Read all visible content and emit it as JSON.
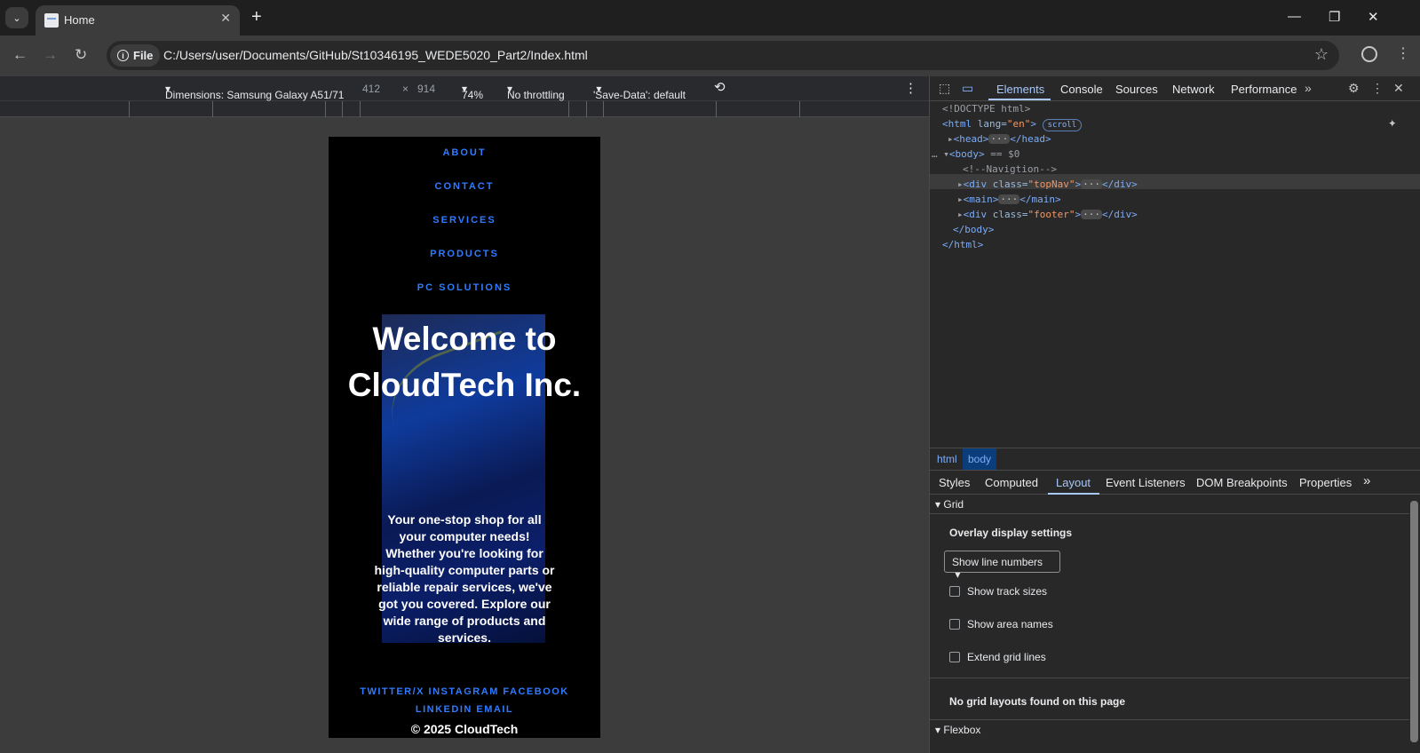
{
  "browser": {
    "tab_title": "Home",
    "url_scheme": "File",
    "url": "C:/Users/user/Documents/GitHub/St10346195_WEDE5020_Part2/Index.html"
  },
  "device_toolbar": {
    "dimensions_label": "Dimensions: Samsung Galaxy A51/71",
    "width": "412",
    "times": "×",
    "height": "914",
    "zoom": "74%",
    "throttling": "No throttling",
    "save_data": "'Save-Data': default"
  },
  "page": {
    "nav": [
      "ABOUT",
      "CONTACT",
      "SERVICES",
      "PRODUCTS",
      "PC SOLUTIONS"
    ],
    "hero_title": "Welcome to CloudTech Inc.",
    "hero_text": "Your one-stop shop for all your computer needs! Whether you're looking for high-quality computer parts or reliable repair services, we've got you covered. Explore our wide range of products and services.",
    "social_row1": "TWITTER/X  INSTAGRAM  FACEBOOK",
    "social_row2": "LINKEDIN  EMAIL",
    "copyright": "© 2025 CloudTech",
    "accent_color": "#2f7bff"
  },
  "devtools": {
    "tabs": [
      "Elements",
      "Console",
      "Sources",
      "Network",
      "Performance"
    ],
    "active_tab": "Elements",
    "dom": {
      "doctype": "<!DOCTYPE html>",
      "html_open": "<html",
      "html_attr": " lang=",
      "html_val": "\"en\"",
      "html_close": ">",
      "scroll_badge": "scroll",
      "head": "<head>",
      "head_end": "</head>",
      "body": "<body>",
      "body_marker": " == $0",
      "comment": "<!--Navigtion-->",
      "div_open": "<div",
      "class_attr": " class=",
      "topnav_val": "\"topNav\"",
      "gt": ">",
      "div_close": "</div>",
      "main_open": "<main>",
      "main_close": "</main>",
      "footer_val": "\"footer\"",
      "body_close": "</body>",
      "html_end": "</html>",
      "ellipsis": "…",
      "row_dots": "···"
    },
    "breadcrumb": [
      "html",
      "body"
    ],
    "panel_tabs": [
      "Styles",
      "Computed",
      "Layout",
      "Event Listeners",
      "DOM Breakpoints",
      "Properties"
    ],
    "active_panel_tab": "Layout",
    "layout": {
      "grid_section": "Grid",
      "overlay_label": "Overlay display settings",
      "select_value": "Show line numbers",
      "checkboxes": [
        "Show track sizes",
        "Show area names",
        "Extend grid lines"
      ],
      "no_grid": "No grid layouts found on this page",
      "flexbox_section": "Flexbox"
    }
  }
}
